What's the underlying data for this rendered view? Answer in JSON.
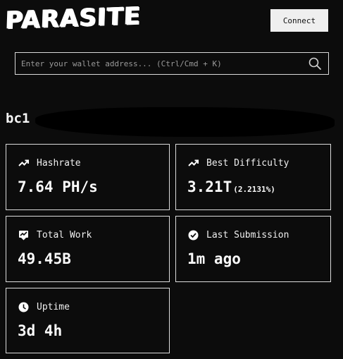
{
  "header": {
    "logo_text": "PARASITE",
    "connect_label": "Connect"
  },
  "search": {
    "placeholder": "Enter your wallet address... (Ctrl/Cmd + K)",
    "value": ""
  },
  "wallet": {
    "address_visible": "bc1"
  },
  "stats": {
    "hashrate": {
      "label": "Hashrate",
      "value": "7.64 PH/s",
      "icon": "trending-up-icon"
    },
    "best_difficulty": {
      "label": "Best Difficulty",
      "value": "3.21T",
      "sub": "(2.2131%)",
      "icon": "trending-up-icon"
    },
    "total_work": {
      "label": "Total Work",
      "value": "49.45B",
      "icon": "chart-badge-icon"
    },
    "last_submission": {
      "label": "Last Submission",
      "value": "1m ago",
      "icon": "check-circle-icon"
    },
    "uptime": {
      "label": "Uptime",
      "value": "3d 4h",
      "icon": "clock-icon"
    }
  }
}
